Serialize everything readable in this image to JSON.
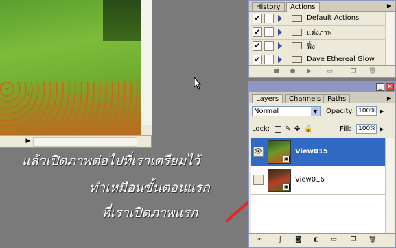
{
  "caption": {
    "line1": "แล้วเปิดภาพต่อไปที่เราเตรียมไว้",
    "line2": "ทำเหมือนขั้นตอนแรก",
    "line3": "ที่เราเปิดภาพแรก"
  },
  "actions_panel": {
    "tabs": [
      "History",
      "Actions"
    ],
    "menu_icon": "panel-menu-arrow",
    "items": [
      {
        "label": "Default Actions",
        "checked": true
      },
      {
        "label": "แต่งภาพ",
        "checked": true
      },
      {
        "label": "ฟิ้ง",
        "checked": true
      },
      {
        "label": "Dave Ethereal Glow",
        "checked": true
      }
    ],
    "toolbar_icons": [
      "stop-icon",
      "record-icon",
      "play-icon",
      "new-set-icon",
      "new-action-icon",
      "delete-icon"
    ]
  },
  "layers_panel": {
    "tabs": [
      "Layers",
      "Channels",
      "Paths"
    ],
    "blend_mode": "Normal",
    "opacity_label": "Opacity:",
    "opacity_value": "100%",
    "lock_label": "Lock:",
    "fill_label": "Fill:",
    "fill_value": "100%",
    "layers": [
      {
        "name": "View015",
        "visible": true,
        "selected": true
      },
      {
        "name": "View016",
        "visible": false,
        "selected": false
      }
    ]
  },
  "colors": {
    "selection": "#316ac5",
    "panel_bg": "#ece9d8",
    "workspace": "#7a7a7a",
    "arrow": "#e8242a"
  }
}
